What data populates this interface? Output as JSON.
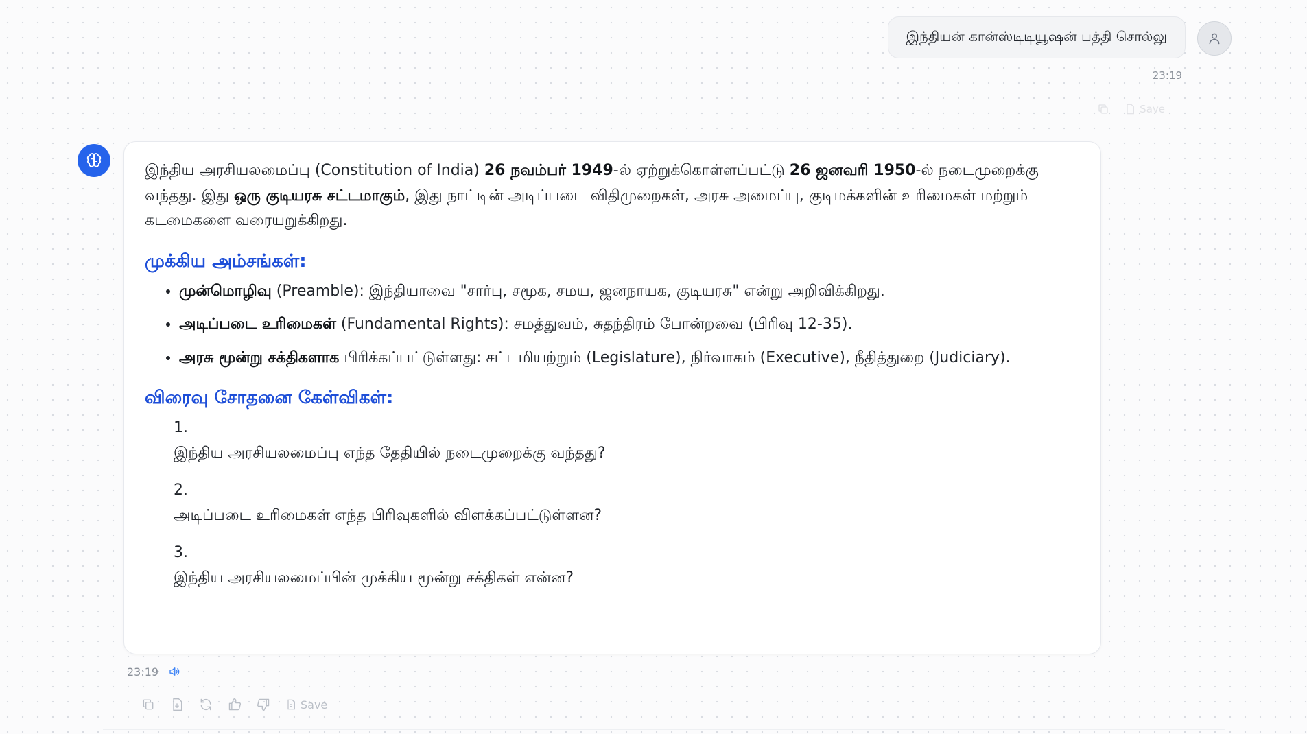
{
  "user_message": {
    "text": "இந்தியன் கான்ஸ்டிடியூஷன் பத்தி சொல்லு",
    "time": "23:19"
  },
  "user_ghost_actions": {
    "save_label": "Save"
  },
  "bot_message": {
    "intro": {
      "p1": "இந்திய அரசியலமைப்பு (Constitution of India) ",
      "b1": "26 நவம்பர் 1949",
      "p2": "-ல் ஏற்றுக்கொள்ளப்பட்டு ",
      "b2": "26 ஜனவரி 1950",
      "p3": "-ல் நடைமுறைக்கு வந்தது. இது ",
      "b3": "ஒரு குடியரசு சட்டமாகும்",
      "p4": ", இது நாட்டின் அடிப்படை விதிமுறைகள், அரசு அமைப்பு, குடிமக்களின் உரிமைகள் மற்றும் கடமைகளை வரையறுக்கிறது."
    },
    "section1_heading": "முக்கிய அம்சங்கள்:",
    "bullets": [
      {
        "bold": "முன்மொழிவு",
        "text": " (Preamble): இந்தியாவை \"சார்பு, சமூக, சமய, ஜனநாயக, குடியரசு\" என்று அறிவிக்கிறது."
      },
      {
        "bold": "அடிப்படை உரிமைகள்",
        "text": " (Fundamental Rights): சமத்துவம், சுதந்திரம் போன்றவை (பிரிவு 12-35)."
      },
      {
        "bold": "அரசு மூன்று சக்திகளாக",
        "text": " பிரிக்கப்பட்டுள்ளது: சட்டமியற்றும் (Legislature), நிர்வாகம் (Executive), நீதித்துறை (Judiciary)."
      }
    ],
    "section2_heading": "விரைவு சோதனை கேள்விகள்:",
    "questions": [
      {
        "num": "1.",
        "text": "இந்திய அரசியலமைப்பு எந்த தேதியில் நடைமுறைக்கு வந்தது?"
      },
      {
        "num": "2.",
        "text": "அடிப்படை உரிமைகள் எந்த பிரிவுகளில் விளக்கப்பட்டுள்ளன?"
      },
      {
        "num": "3.",
        "text": "இந்திய அரசியலமைப்பின் முக்கிய மூன்று சக்திகள் என்ன?"
      }
    ],
    "time": "23:19"
  },
  "bot_actions": {
    "save_label": "Save"
  },
  "icons": {
    "user_avatar": "user-icon",
    "bot_avatar": "brain-icon",
    "speaker": "speaker-icon",
    "copy": "copy-icon",
    "export": "export-icon",
    "regenerate": "refresh-icon",
    "like": "thumbs-up-icon",
    "dislike": "thumbs-down-icon",
    "save": "document-icon"
  },
  "colors": {
    "accent": "#2563eb",
    "heading": "#1d4ed8",
    "speaker": "#3b82f6"
  }
}
